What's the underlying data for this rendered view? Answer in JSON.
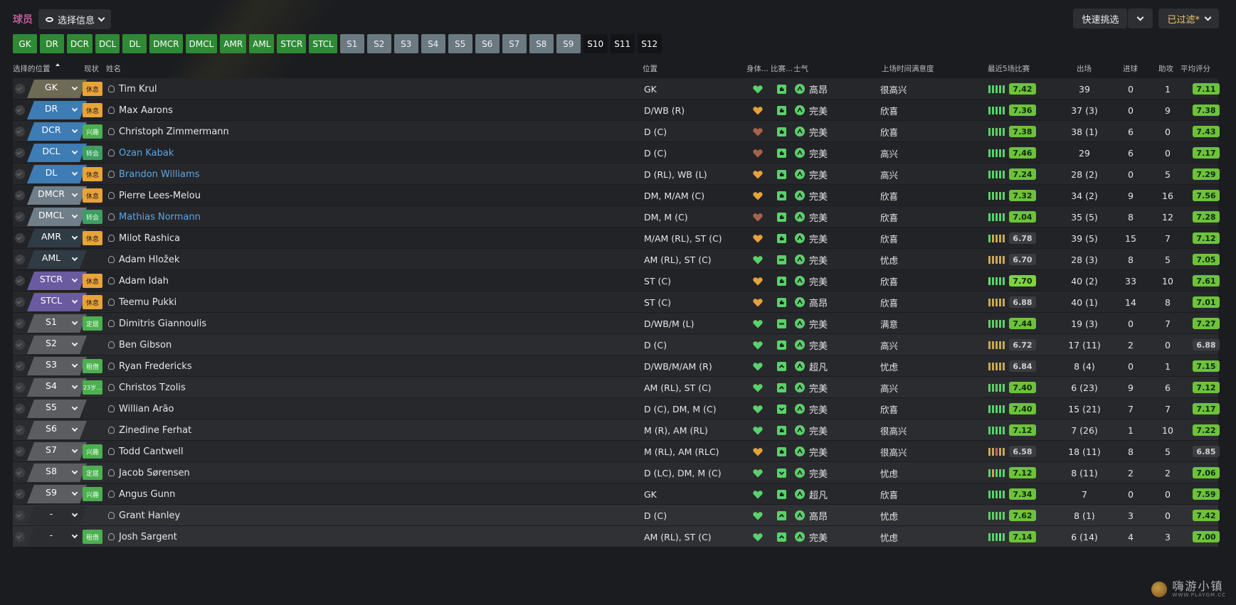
{
  "header": {
    "title": "球员",
    "view_select_label": "选择信息",
    "quick_pick_label": "快速挑选",
    "filtered_label": "已过滤*"
  },
  "position_tags": [
    {
      "label": "GK",
      "style": "green"
    },
    {
      "label": "DR",
      "style": "green"
    },
    {
      "label": "DCR",
      "style": "green"
    },
    {
      "label": "DCL",
      "style": "green"
    },
    {
      "label": "DL",
      "style": "green"
    },
    {
      "label": "DMCR",
      "style": "green"
    },
    {
      "label": "DMCL",
      "style": "green"
    },
    {
      "label": "AMR",
      "style": "green"
    },
    {
      "label": "AML",
      "style": "green"
    },
    {
      "label": "STCR",
      "style": "green"
    },
    {
      "label": "STCL",
      "style": "green"
    },
    {
      "label": "S1",
      "style": "grey"
    },
    {
      "label": "S2",
      "style": "grey"
    },
    {
      "label": "S3",
      "style": "grey"
    },
    {
      "label": "S4",
      "style": "grey"
    },
    {
      "label": "S5",
      "style": "grey"
    },
    {
      "label": "S6",
      "style": "grey"
    },
    {
      "label": "S7",
      "style": "grey"
    },
    {
      "label": "S8",
      "style": "grey"
    },
    {
      "label": "S9",
      "style": "grey"
    },
    {
      "label": "S10",
      "style": "dark"
    },
    {
      "label": "S11",
      "style": "dark"
    },
    {
      "label": "S12",
      "style": "dark"
    }
  ],
  "columns": {
    "selected_position": "选择的位置",
    "status": "现状",
    "name": "姓名",
    "position": "位置",
    "condition": "身体...",
    "match_fitness": "比赛...",
    "morale": "士气",
    "playing_time": "上场时间满意度",
    "last5": "最近5场比赛",
    "apps": "出场",
    "goals": "进球",
    "assists": "助攻",
    "avg_rating": "平均评分"
  },
  "colors": {
    "gk": "#6d6a55",
    "def": "#3d7cb5",
    "dm": "#6f7e88",
    "am": "#2f3b45",
    "st": "#6a5aa0",
    "sub": "#5c5d60",
    "none": "#2c2d30",
    "heart_green": "#5ad16a",
    "heart_orange": "#e5a23a",
    "heart_brown": "#a8624a",
    "rating_good": "#6ec23a",
    "link": "#5aa6e6"
  },
  "rows": [
    {
      "pos": "GK",
      "pcol": "gk",
      "status": "休息",
      "scls": "rest",
      "name": "Tim Krul",
      "link": false,
      "position": "GK",
      "heart": "green",
      "mf": "up",
      "morale": "高昂",
      "mor_icon": "up",
      "happy": "很高兴",
      "bars": [
        "g",
        "g",
        "g",
        "g",
        "g"
      ],
      "rating": "7.42",
      "rcls": "good",
      "apps": "39",
      "goals": "0",
      "assists": "1",
      "avg": "7.11",
      "acls": "good"
    },
    {
      "pos": "DR",
      "pcol": "def",
      "status": "休息",
      "scls": "rest",
      "name": "Max Aarons",
      "link": false,
      "position": "D/WB (R)",
      "heart": "orange",
      "mf": "up",
      "morale": "完美",
      "mor_icon": "up",
      "happy": "欣喜",
      "bars": [
        "g",
        "g",
        "g",
        "g",
        "g"
      ],
      "rating": "7.36",
      "rcls": "good",
      "apps": "37 (3)",
      "goals": "0",
      "assists": "9",
      "avg": "7.38",
      "acls": "good"
    },
    {
      "pos": "DCR",
      "pcol": "def",
      "status": "兴趣",
      "scls": "interest",
      "name": "Christoph Zimmermann",
      "link": false,
      "position": "D (C)",
      "heart": "brown",
      "mf": "up",
      "morale": "完美",
      "mor_icon": "up",
      "happy": "欣喜",
      "bars": [
        "g",
        "g",
        "g",
        "g",
        "g"
      ],
      "rating": "7.38",
      "rcls": "good",
      "apps": "38 (1)",
      "goals": "6",
      "assists": "0",
      "avg": "7.43",
      "acls": "good"
    },
    {
      "pos": "DCL",
      "pcol": "def",
      "status": "转会",
      "scls": "transfer",
      "name": "Ozan Kabak",
      "link": true,
      "position": "D (C)",
      "heart": "brown",
      "mf": "up",
      "morale": "完美",
      "mor_icon": "up",
      "happy": "高兴",
      "bars": [
        "g",
        "g",
        "g",
        "g",
        "g"
      ],
      "rating": "7.46",
      "rcls": "good",
      "apps": "29",
      "goals": "6",
      "assists": "0",
      "avg": "7.17",
      "acls": "good"
    },
    {
      "pos": "DL",
      "pcol": "def",
      "status": "休息",
      "scls": "rest",
      "name": "Brandon Williams",
      "link": true,
      "position": "D (RL), WB (L)",
      "heart": "orange",
      "mf": "up",
      "morale": "完美",
      "mor_icon": "up",
      "happy": "高兴",
      "bars": [
        "g",
        "g",
        "g",
        "g",
        "g"
      ],
      "rating": "7.24",
      "rcls": "good",
      "apps": "28 (2)",
      "goals": "0",
      "assists": "5",
      "avg": "7.29",
      "acls": "good"
    },
    {
      "pos": "DMCR",
      "pcol": "dm",
      "status": "休息",
      "scls": "rest",
      "name": "Pierre Lees-Melou",
      "link": false,
      "position": "DM, M/AM (C)",
      "heart": "orange",
      "mf": "up",
      "morale": "完美",
      "mor_icon": "up",
      "happy": "欣喜",
      "bars": [
        "g",
        "g",
        "g",
        "g",
        "g"
      ],
      "rating": "7.32",
      "rcls": "good",
      "apps": "34 (2)",
      "goals": "9",
      "assists": "16",
      "avg": "7.56",
      "acls": "good"
    },
    {
      "pos": "DMCL",
      "pcol": "dm",
      "status": "转会",
      "scls": "transfer",
      "name": "Mathias Normann",
      "link": true,
      "position": "DM, M (C)",
      "heart": "brown",
      "mf": "up",
      "morale": "完美",
      "mor_icon": "up",
      "happy": "欣喜",
      "bars": [
        "g",
        "g",
        "g",
        "g",
        "g"
      ],
      "rating": "7.04",
      "rcls": "good",
      "apps": "35 (5)",
      "goals": "8",
      "assists": "12",
      "avg": "7.28",
      "acls": "good"
    },
    {
      "pos": "AMR",
      "pcol": "am",
      "status": "休息",
      "scls": "rest",
      "name": "Milot Rashica",
      "link": false,
      "position": "M/AM (RL), ST (C)",
      "heart": "orange",
      "mf": "up",
      "morale": "完美",
      "mor_icon": "up",
      "happy": "欣喜",
      "bars": [
        "g",
        "y",
        "y",
        "y",
        "y"
      ],
      "rating": "6.78",
      "rcls": "mid",
      "apps": "39 (5)",
      "goals": "15",
      "assists": "7",
      "avg": "7.12",
      "acls": "good"
    },
    {
      "pos": "AML",
      "pcol": "am",
      "status": "",
      "scls": "",
      "name": "Adam Hložek",
      "link": false,
      "position": "AM (RL), ST (C)",
      "heart": "green",
      "mf": "dash",
      "morale": "完美",
      "mor_icon": "up",
      "happy": "忧虑",
      "bars": [
        "y",
        "y",
        "y",
        "y",
        "y"
      ],
      "rating": "6.70",
      "rcls": "mid",
      "apps": "28 (3)",
      "goals": "8",
      "assists": "5",
      "avg": "7.05",
      "acls": "good"
    },
    {
      "pos": "STCR",
      "pcol": "st",
      "status": "休息",
      "scls": "rest",
      "name": "Adam Idah",
      "link": false,
      "position": "ST (C)",
      "heart": "orange",
      "mf": "up",
      "morale": "完美",
      "mor_icon": "up",
      "happy": "欣喜",
      "bars": [
        "G",
        "g",
        "g",
        "g",
        "g"
      ],
      "rating": "7.70",
      "rcls": "high",
      "apps": "40 (2)",
      "goals": "33",
      "assists": "10",
      "avg": "7.61",
      "acls": "good"
    },
    {
      "pos": "STCL",
      "pcol": "st",
      "status": "休息",
      "scls": "rest",
      "name": "Teemu Pukki",
      "link": false,
      "position": "ST (C)",
      "heart": "orange",
      "mf": "up",
      "morale": "高昂",
      "mor_icon": "up",
      "happy": "欣喜",
      "bars": [
        "y",
        "y",
        "y",
        "y",
        "y"
      ],
      "rating": "6.88",
      "rcls": "mid",
      "apps": "40 (1)",
      "goals": "14",
      "assists": "8",
      "avg": "7.01",
      "acls": "good"
    },
    {
      "pos": "S1",
      "pcol": "sub",
      "status": "定居",
      "scls": "settled",
      "name": "Dimitris Giannoulis",
      "link": false,
      "position": "D/WB/M (L)",
      "heart": "green",
      "mf": "dash",
      "morale": "完美",
      "mor_icon": "up",
      "happy": "满意",
      "bars": [
        "g",
        "g",
        "g",
        "g",
        "g"
      ],
      "rating": "7.44",
      "rcls": "good",
      "apps": "19 (3)",
      "goals": "0",
      "assists": "7",
      "avg": "7.27",
      "acls": "good"
    },
    {
      "pos": "S2",
      "pcol": "sub",
      "status": "",
      "scls": "",
      "name": "Ben Gibson",
      "link": false,
      "position": "D (C)",
      "heart": "green",
      "mf": "up",
      "morale": "完美",
      "mor_icon": "up",
      "happy": "高兴",
      "bars": [
        "y",
        "y",
        "y",
        "y",
        "y"
      ],
      "rating": "6.72",
      "rcls": "mid",
      "apps": "17 (11)",
      "goals": "2",
      "assists": "0",
      "avg": "6.88",
      "acls": "mid"
    },
    {
      "pos": "S3",
      "pcol": "sub",
      "status": "租借",
      "scls": "loan",
      "name": "Ryan Fredericks",
      "link": false,
      "position": "D/WB/M/AM (R)",
      "heart": "green",
      "mf": "chev",
      "morale": "超凡",
      "mor_icon": "up",
      "happy": "忧虑",
      "bars": [
        "y",
        "y",
        "y",
        "y",
        "y"
      ],
      "rating": "6.84",
      "rcls": "mid",
      "apps": "8 (4)",
      "goals": "0",
      "assists": "1",
      "avg": "7.15",
      "acls": "good"
    },
    {
      "pos": "S4",
      "pcol": "sub",
      "status": "23岁...",
      "scls": "age",
      "name": "Christos Tzolis",
      "link": false,
      "position": "AM (RL), ST (C)",
      "heart": "green",
      "mf": "chev",
      "morale": "完美",
      "mor_icon": "up",
      "happy": "高兴",
      "bars": [
        "g",
        "g",
        "g",
        "g",
        "g"
      ],
      "rating": "7.40",
      "rcls": "good",
      "apps": "6 (23)",
      "goals": "9",
      "assists": "6",
      "avg": "7.12",
      "acls": "good"
    },
    {
      "pos": "S5",
      "pcol": "sub",
      "status": "",
      "scls": "",
      "name": "Willian Arão",
      "link": false,
      "position": "D (C), DM, M (C)",
      "heart": "green",
      "mf": "check",
      "morale": "完美",
      "mor_icon": "up",
      "happy": "欣喜",
      "bars": [
        "g",
        "g",
        "g",
        "g",
        "g"
      ],
      "rating": "7.40",
      "rcls": "good",
      "apps": "15 (21)",
      "goals": "7",
      "assists": "7",
      "avg": "7.17",
      "acls": "good"
    },
    {
      "pos": "S6",
      "pcol": "sub",
      "status": "",
      "scls": "",
      "name": "Zinedine Ferhat",
      "link": false,
      "position": "M (R), AM (RL)",
      "heart": "green",
      "mf": "up",
      "morale": "完美",
      "mor_icon": "up",
      "happy": "很高兴",
      "bars": [
        "g",
        "g",
        "g",
        "g",
        "g"
      ],
      "rating": "7.12",
      "rcls": "good",
      "apps": "7 (26)",
      "goals": "1",
      "assists": "10",
      "avg": "7.22",
      "acls": "good"
    },
    {
      "pos": "S7",
      "pcol": "sub",
      "status": "兴趣",
      "scls": "interest",
      "name": "Todd Cantwell",
      "link": false,
      "position": "M (RL), AM (RLC)",
      "heart": "orange",
      "mf": "up",
      "morale": "完美",
      "mor_icon": "up",
      "happy": "很高兴",
      "bars": [
        "y",
        "y",
        "r",
        "y",
        "y"
      ],
      "rating": "6.58",
      "rcls": "mid",
      "apps": "18 (11)",
      "goals": "8",
      "assists": "5",
      "avg": "6.85",
      "acls": "mid"
    },
    {
      "pos": "S8",
      "pcol": "sub",
      "status": "定居",
      "scls": "settled",
      "name": "Jacob Sørensen",
      "link": false,
      "position": "D (LC), DM, M (C)",
      "heart": "green",
      "mf": "check",
      "morale": "完美",
      "mor_icon": "up",
      "happy": "忧虑",
      "bars": [
        "g",
        "y",
        "g",
        "g",
        "g"
      ],
      "rating": "7.12",
      "rcls": "good",
      "apps": "8 (11)",
      "goals": "2",
      "assists": "2",
      "avg": "7.06",
      "acls": "good"
    },
    {
      "pos": "S9",
      "pcol": "sub",
      "status": "兴趣",
      "scls": "interest",
      "name": "Angus Gunn",
      "link": false,
      "position": "GK",
      "heart": "green",
      "mf": "up",
      "morale": "超凡",
      "mor_icon": "up",
      "happy": "欣喜",
      "bars": [
        "g",
        "g",
        "g",
        "g",
        "g"
      ],
      "rating": "7.34",
      "rcls": "good",
      "apps": "7",
      "goals": "0",
      "assists": "0",
      "avg": "7.59",
      "acls": "good"
    },
    {
      "pos": "-",
      "pcol": "none",
      "status": "",
      "scls": "",
      "name": "Grant Hanley",
      "link": false,
      "position": "D (C)",
      "heart": "green",
      "mf": "chev",
      "morale": "高昂",
      "mor_icon": "up",
      "happy": "忧虑",
      "bars": [
        "g",
        "g",
        "g",
        "g",
        "g"
      ],
      "rating": "7.62",
      "rcls": "good",
      "apps": "8 (1)",
      "goals": "3",
      "assists": "0",
      "avg": "7.42",
      "acls": "good"
    },
    {
      "pos": "-",
      "pcol": "none",
      "status": "租借",
      "scls": "loan",
      "name": "Josh Sargent",
      "link": false,
      "position": "AM (RL), ST (C)",
      "heart": "green",
      "mf": "chev",
      "morale": "完美",
      "mor_icon": "up",
      "happy": "忧虑",
      "bars": [
        "g",
        "g",
        "g",
        "G",
        "g"
      ],
      "rating": "7.14",
      "rcls": "good",
      "apps": "6 (14)",
      "goals": "4",
      "assists": "3",
      "avg": "7.00",
      "acls": "good"
    }
  ],
  "watermark": {
    "text": "嗨游小镇",
    "sub": "WWW.PLAYGM.CC"
  }
}
